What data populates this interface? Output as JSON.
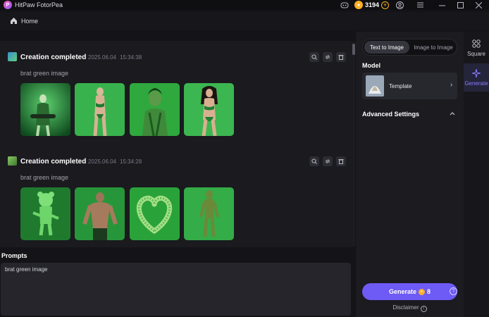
{
  "window": {
    "app_title": "HitPaw FotorPea",
    "coins": "3194",
    "icons": [
      "discord-icon",
      "coin-icon",
      "plus-icon",
      "user-icon",
      "menu-icon",
      "minimize-icon",
      "maximize-icon",
      "close-icon"
    ]
  },
  "header": {
    "home_label": "Home"
  },
  "feed": {
    "items": [
      {
        "title": "Creation completed",
        "date": "2025.06.04",
        "time": "15:34:38",
        "prompt": "brat green image"
      },
      {
        "title": "Creation completed",
        "date": "2025.06.04",
        "time": "15:34:28",
        "prompt": "brat green image"
      }
    ]
  },
  "prompts": {
    "label": "Prompts",
    "value": "brat green image"
  },
  "panel": {
    "tabs": [
      "Text to Image",
      "Image to Image"
    ],
    "active_tab": "Text to Image",
    "model_label": "Model",
    "model_name": "Template",
    "advanced_label": "Advanced Settings",
    "generate_label": "Generate",
    "generate_cost": "8",
    "disclaimer": "Disclaimer"
  },
  "nav": {
    "square": "Square",
    "generate": "Generate"
  },
  "colors": {
    "accent": "#6e5af5",
    "coin": "#ffb020",
    "background": "#141418",
    "image_green": "#2fb34a"
  }
}
